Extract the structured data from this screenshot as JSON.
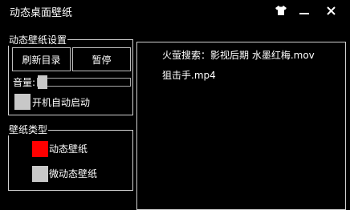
{
  "window": {
    "title": "动态桌面壁纸",
    "icons": {
      "skin": "tshirt-icon",
      "minimize": "minimize-icon",
      "close": "close-icon"
    },
    "close_glyph": "✕"
  },
  "settings": {
    "group_title": "动态壁纸设置",
    "refresh_button": "刷新目录",
    "pause_button": "暂停",
    "volume_label": "音量:",
    "volume_level": 0.0,
    "autostart_label": "开机自动启动",
    "autostart_checked": false
  },
  "wallpaper_type": {
    "group_title": "壁纸类型",
    "options": [
      {
        "label": "动态壁纸",
        "selected": true,
        "color": "#ff0000"
      },
      {
        "label": "微动态壁纸",
        "selected": false,
        "color": "#c8c8c8"
      }
    ]
  },
  "file_list": {
    "items": [
      {
        "name": "火萤搜索：影视后期 水墨红梅.mov"
      },
      {
        "name": "狙击手.mp4"
      }
    ]
  },
  "colors": {
    "background": "#000000",
    "border": "#d0d0d0",
    "checkbox_unchecked": "#c8c8c8",
    "selected_red": "#ff0000"
  }
}
